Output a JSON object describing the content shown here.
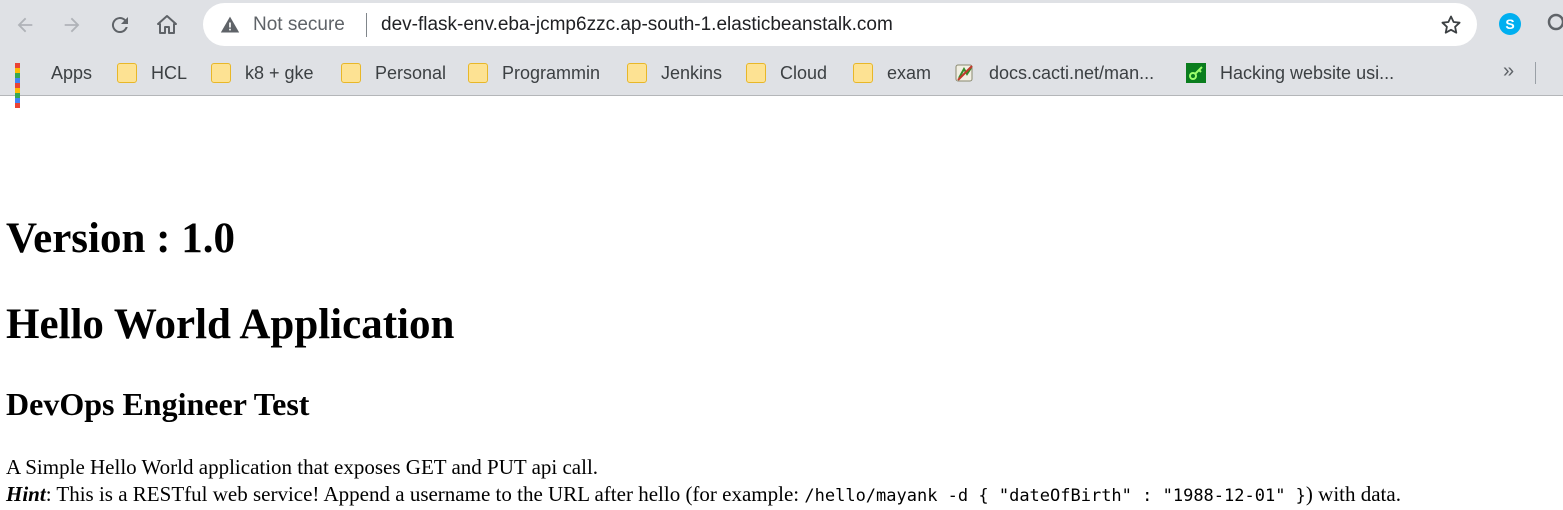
{
  "browser": {
    "security_label": "Not secure",
    "url": "dev-flask-env.eba-jcmp6zzc.ap-south-1.elasticbeanstalk.com",
    "nav_icons": [
      "back-arrow-icon",
      "forward-arrow-icon",
      "reload-icon",
      "home-icon"
    ],
    "extension_icons": [
      "skype-icon",
      "search-icon"
    ]
  },
  "bookmarks": [
    {
      "label": "Apps",
      "icon": "apps-grid-icon"
    },
    {
      "label": "HCL",
      "icon": "folder-icon"
    },
    {
      "label": "k8 + gke",
      "icon": "folder-icon"
    },
    {
      "label": "Personal",
      "icon": "folder-icon"
    },
    {
      "label": "Programmin",
      "icon": "folder-icon"
    },
    {
      "label": "Jenkins",
      "icon": "folder-icon"
    },
    {
      "label": "Cloud",
      "icon": "folder-icon"
    },
    {
      "label": "exam",
      "icon": "folder-icon"
    },
    {
      "label": "docs.cacti.net/man...",
      "icon": "cacti-favicon"
    },
    {
      "label": "Hacking website usi...",
      "icon": "green-key-favicon"
    }
  ],
  "bookmarks_overflow": "»",
  "page": {
    "version_heading": "Version : 1.0",
    "app_heading": "Hello World Application",
    "subheading": "DevOps Engineer Test",
    "description": "A Simple Hello World application that exposes GET and PUT api call.",
    "hint_label": "Hint",
    "hint_text_before": ": This is a RESTful web service! Append a username to the URL after hello (for example: ",
    "hint_code": "/hello/mayank -d { \"dateOfBirth\" : \"1988-12-01\" }",
    "hint_text_after": ") with data."
  },
  "colors": {
    "chrome_bg": "#dfe1e5",
    "omnibox_bg": "#ffffff",
    "folder_fill": "#fde293",
    "folder_border": "#e8b728"
  }
}
